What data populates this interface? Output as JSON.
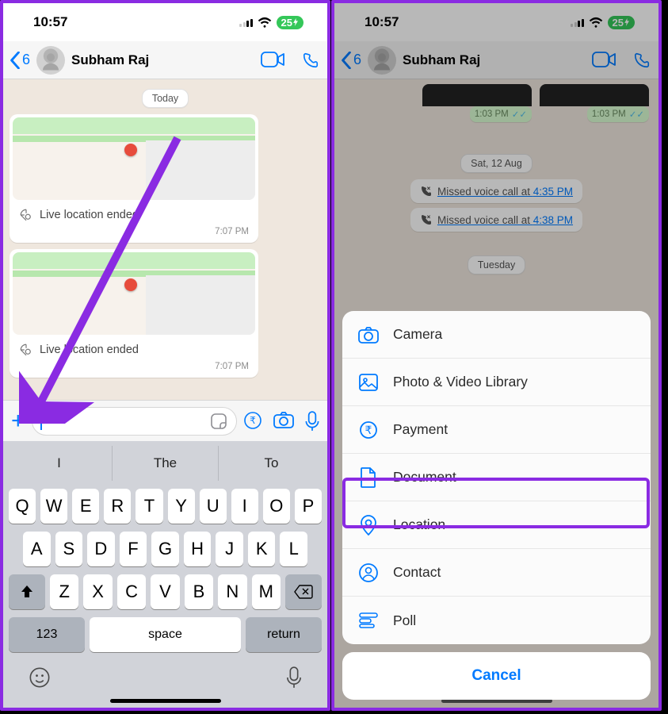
{
  "status": {
    "time": "10:57",
    "battery_text": "25"
  },
  "nav": {
    "back_count": "6",
    "contact": "Subham Raj"
  },
  "chat": {
    "day_label": "Today",
    "messages": [
      {
        "caption": "Live location ended",
        "time": "7:07 PM"
      },
      {
        "caption": "Live location ended",
        "time": "7:07 PM"
      }
    ]
  },
  "keyboard": {
    "predictions": [
      "I",
      "The",
      "To"
    ],
    "rows": [
      [
        "Q",
        "W",
        "E",
        "R",
        "T",
        "Y",
        "U",
        "I",
        "O",
        "P"
      ],
      [
        "A",
        "S",
        "D",
        "F",
        "G",
        "H",
        "J",
        "K",
        "L"
      ],
      [
        "Z",
        "X",
        "C",
        "V",
        "B",
        "N",
        "M"
      ]
    ],
    "numeric": "123",
    "space": "space",
    "return": "return"
  },
  "right_chat": {
    "sent_times": [
      "1:03 PM",
      "1:03 PM"
    ],
    "date_label": "Sat, 12 Aug",
    "missed": [
      {
        "prefix": "Missed voice call at ",
        "time": "4:35 PM"
      },
      {
        "prefix": "Missed voice call at ",
        "time": "4:38 PM"
      }
    ],
    "tuesday": "Tuesday"
  },
  "sheet": {
    "items": [
      {
        "label": "Camera"
      },
      {
        "label": "Photo & Video Library"
      },
      {
        "label": "Payment"
      },
      {
        "label": "Document"
      },
      {
        "label": "Location"
      },
      {
        "label": "Contact"
      },
      {
        "label": "Poll"
      }
    ],
    "cancel": "Cancel"
  }
}
